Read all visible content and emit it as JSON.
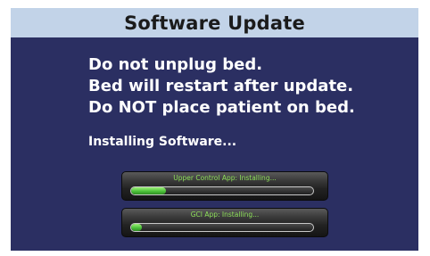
{
  "dialog": {
    "title": "Software Update",
    "warnings": [
      "Do not unplug bed.",
      "Bed will restart after update.",
      "Do NOT place patient on bed."
    ],
    "status_text": "Installing Software...",
    "progress_items": [
      {
        "label": "Upper Control App: Installing...",
        "progress": 0.19
      },
      {
        "label": "GCI App: Installing...",
        "progress": 0.06
      }
    ]
  },
  "colors": {
    "title_bar": "#c2d3e8",
    "background": "#2b2f62",
    "progress_text": "#8ee05a",
    "progress_fill": "#4cc23a"
  }
}
